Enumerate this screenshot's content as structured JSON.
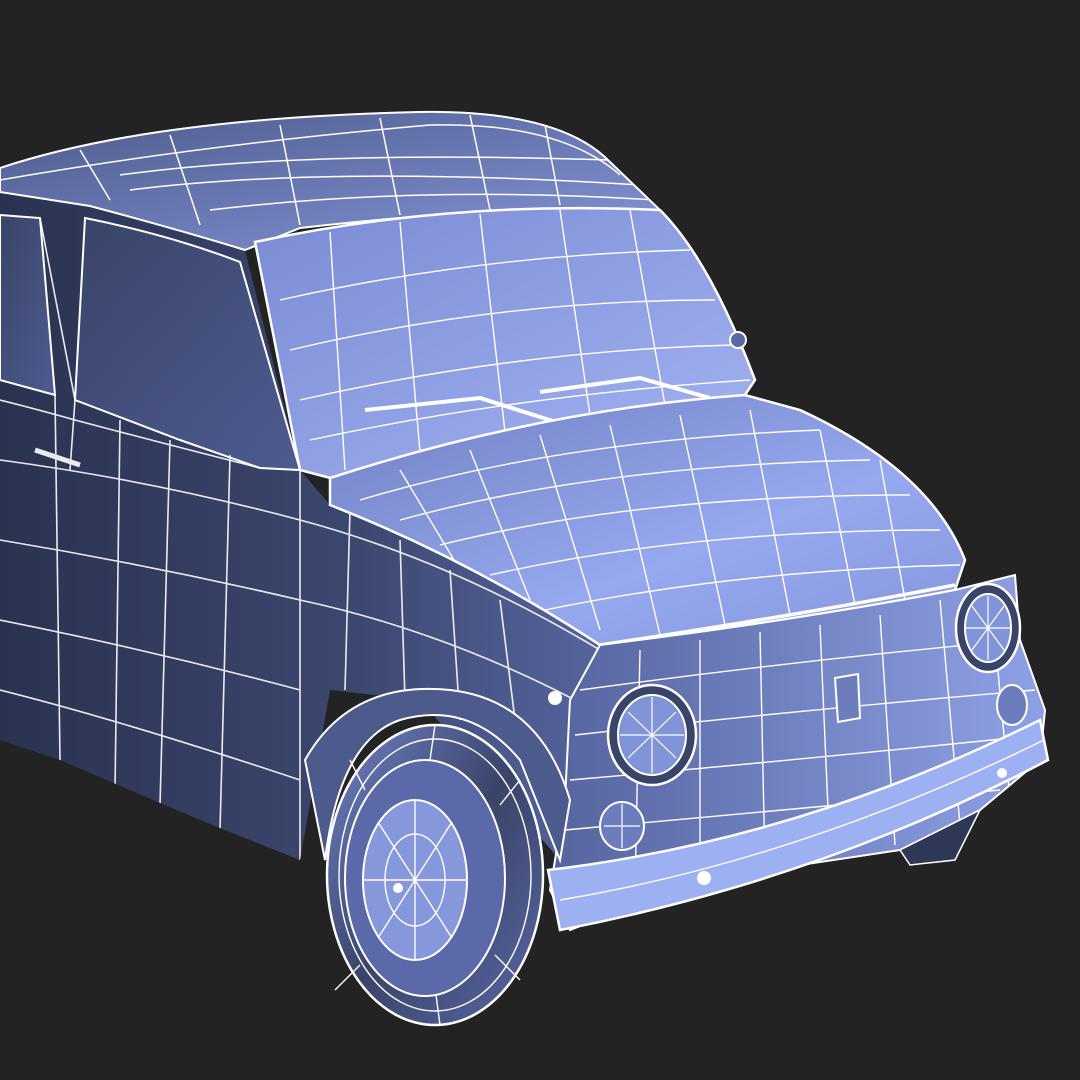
{
  "viewport": {
    "background": "#232323",
    "subject": "car-wireframe-render"
  },
  "model": {
    "shade_light": "#8c9fe6",
    "shade_mid": "#6675b6",
    "shade_dark": "#323a58",
    "wire_color": "#ffffff",
    "shading": "flat-shaded-with-wireframe-overlay"
  }
}
